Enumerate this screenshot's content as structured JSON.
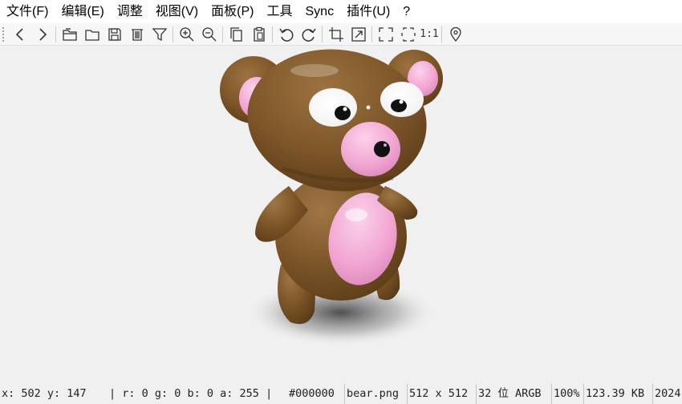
{
  "menu": [
    {
      "label": "文件(F)",
      "name": "menu-file"
    },
    {
      "label": "编辑(E)",
      "name": "menu-edit"
    },
    {
      "label": "调整",
      "name": "menu-adjust"
    },
    {
      "label": "视图(V)",
      "name": "menu-view"
    },
    {
      "label": "面板(P)",
      "name": "menu-panel"
    },
    {
      "label": "工具",
      "name": "menu-tools"
    },
    {
      "label": "Sync",
      "name": "menu-sync"
    },
    {
      "label": "插件(U)",
      "name": "menu-plugins"
    },
    {
      "label": "?",
      "name": "menu-help"
    }
  ],
  "toolbar": {
    "icons": [
      "back-icon",
      "forward-icon",
      "open-folder-icon",
      "folder-icon",
      "save-icon",
      "delete-icon",
      "filter-icon",
      "zoom-in-icon",
      "zoom-out-icon",
      "copy-icon",
      "paste-icon",
      "rotate-left-icon",
      "rotate-right-icon",
      "crop-icon",
      "resize-icon",
      "fit-window-icon",
      "fit-width-icon",
      "actual-size-icon",
      "location-pin-icon"
    ],
    "actual_size_label": "1:1"
  },
  "canvas": {
    "background_color": "#f0f0f0",
    "image_subject": "brown teddy bear with pink ears, nose and belly"
  },
  "status": {
    "coords": "x: 502 y: 147",
    "pixel": "| r: 0 g: 0 b: 0 a: 255 |",
    "hex": "#000000",
    "filename": "bear.png",
    "dimensions": "512 x 512",
    "bit_depth": "32 位 ARGB",
    "zoom": "100%",
    "filesize": "123.39 KB",
    "date": "2024"
  },
  "colors": {
    "bear_brown": "#7a5427",
    "bear_pink": "#f2a6d2",
    "eye_white": "#ffffff",
    "pupil": "#111111"
  }
}
